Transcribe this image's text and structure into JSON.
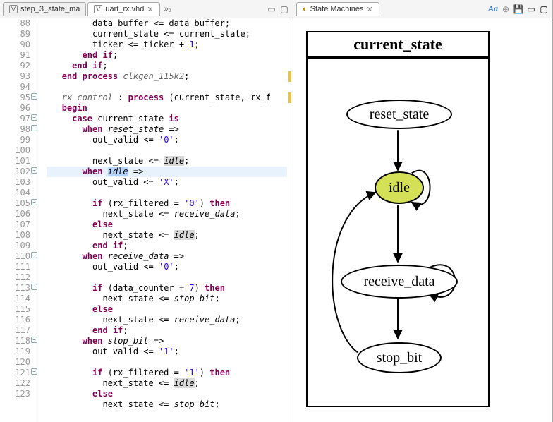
{
  "left": {
    "tabs": [
      {
        "icon": "V",
        "label": "step_3_state_ma",
        "active": false
      },
      {
        "icon": "V",
        "label": "uart_rx.vhd",
        "active": true
      }
    ],
    "overflow": "»₂",
    "lines": [
      {
        "n": 88,
        "fold": "",
        "chg": false,
        "cur": false,
        "html": "         data_buffer <span class='op'>&lt;=</span> data_buffer;"
      },
      {
        "n": 89,
        "fold": "",
        "chg": false,
        "cur": false,
        "html": "         current_state <span class='op'>&lt;=</span> current_state;"
      },
      {
        "n": 90,
        "fold": "",
        "chg": false,
        "cur": false,
        "html": "         ticker <span class='op'>&lt;=</span> ticker <span class='op'>+</span> <span class='num'>1</span>;"
      },
      {
        "n": 91,
        "fold": "",
        "chg": false,
        "cur": false,
        "html": "       <span class='kw'>end</span> <span class='kw'>if</span>;"
      },
      {
        "n": 92,
        "fold": "",
        "chg": false,
        "cur": false,
        "html": "     <span class='kw'>end</span> <span class='kw'>if</span>;"
      },
      {
        "n": 93,
        "fold": "",
        "chg": true,
        "cur": false,
        "html": "   <span class='kw'>end</span> <span class='kw'>process</span> <span class='lbl'>clkgen_115k2</span>;"
      },
      {
        "n": 94,
        "fold": "",
        "chg": false,
        "cur": false,
        "html": ""
      },
      {
        "n": 95,
        "fold": "-",
        "chg": true,
        "cur": false,
        "html": "   <span class='lbl'>rx_control</span> : <span class='kw'>process</span> (current_state, rx_f"
      },
      {
        "n": 96,
        "fold": "",
        "chg": false,
        "cur": false,
        "html": "   <span class='kw'>begin</span>"
      },
      {
        "n": 97,
        "fold": "-",
        "chg": false,
        "cur": false,
        "html": "     <span class='kw'>case</span> current_state <span class='kw'>is</span>"
      },
      {
        "n": 98,
        "fold": "-",
        "chg": false,
        "cur": false,
        "html": "       <span class='kw'>when</span> <span class='ital'>reset_state</span> <span class='op'>=&gt;</span>"
      },
      {
        "n": 99,
        "fold": "",
        "chg": false,
        "cur": false,
        "html": "         out_valid <span class='op'>&lt;=</span> <span class='str'>'0'</span>;"
      },
      {
        "n": 100,
        "fold": "",
        "chg": false,
        "cur": false,
        "html": ""
      },
      {
        "n": 101,
        "fold": "",
        "chg": false,
        "cur": false,
        "html": "         next_state <span class='op'>&lt;=</span> <span class='hl'>idle</span>;"
      },
      {
        "n": 102,
        "fold": "-",
        "chg": false,
        "cur": true,
        "html": "       <span class='kw'>when</span> <span class='sel'>idle</span> <span class='op'>=&gt;</span>"
      },
      {
        "n": 103,
        "fold": "",
        "chg": false,
        "cur": false,
        "html": "         out_valid <span class='op'>&lt;=</span> <span class='str'>'X'</span>;"
      },
      {
        "n": 104,
        "fold": "",
        "chg": false,
        "cur": false,
        "html": ""
      },
      {
        "n": 105,
        "fold": "-",
        "chg": false,
        "cur": false,
        "html": "         <span class='kw'>if</span> (rx_filtered <span class='op'>=</span> <span class='str'>'0'</span>) <span class='kw'>then</span>"
      },
      {
        "n": 106,
        "fold": "",
        "chg": false,
        "cur": false,
        "html": "           next_state <span class='op'>&lt;=</span> <span class='ital'>receive_data</span>;"
      },
      {
        "n": 107,
        "fold": "",
        "chg": false,
        "cur": false,
        "html": "         <span class='kw'>else</span>"
      },
      {
        "n": 108,
        "fold": "",
        "chg": false,
        "cur": false,
        "html": "           next_state <span class='op'>&lt;=</span> <span class='hl'>idle</span>;"
      },
      {
        "n": 109,
        "fold": "",
        "chg": false,
        "cur": false,
        "html": "         <span class='kw'>end</span> <span class='kw'>if</span>;"
      },
      {
        "n": 110,
        "fold": "-",
        "chg": false,
        "cur": false,
        "html": "       <span class='kw'>when</span> <span class='ital'>receive_data</span> <span class='op'>=&gt;</span>"
      },
      {
        "n": 111,
        "fold": "",
        "chg": false,
        "cur": false,
        "html": "         out_valid <span class='op'>&lt;=</span> <span class='str'>'0'</span>;"
      },
      {
        "n": 112,
        "fold": "",
        "chg": false,
        "cur": false,
        "html": ""
      },
      {
        "n": 113,
        "fold": "-",
        "chg": false,
        "cur": false,
        "html": "         <span class='kw'>if</span> (data_counter <span class='op'>=</span> <span class='num'>7</span>) <span class='kw'>then</span>"
      },
      {
        "n": 114,
        "fold": "",
        "chg": false,
        "cur": false,
        "html": "           next_state <span class='op'>&lt;=</span> <span class='ital'>stop_bit</span>;"
      },
      {
        "n": 115,
        "fold": "",
        "chg": false,
        "cur": false,
        "html": "         <span class='kw'>else</span>"
      },
      {
        "n": 116,
        "fold": "",
        "chg": false,
        "cur": false,
        "html": "           next_state <span class='op'>&lt;=</span> <span class='ital'>receive_data</span>;"
      },
      {
        "n": 117,
        "fold": "",
        "chg": false,
        "cur": false,
        "html": "         <span class='kw'>end</span> <span class='kw'>if</span>;"
      },
      {
        "n": 118,
        "fold": "-",
        "chg": false,
        "cur": false,
        "html": "       <span class='kw'>when</span> <span class='ital'>stop_bit</span> <span class='op'>=&gt;</span>"
      },
      {
        "n": 119,
        "fold": "",
        "chg": false,
        "cur": false,
        "html": "         out_valid <span class='op'>&lt;=</span> <span class='str'>'1'</span>;"
      },
      {
        "n": 120,
        "fold": "",
        "chg": false,
        "cur": false,
        "html": ""
      },
      {
        "n": 121,
        "fold": "-",
        "chg": false,
        "cur": false,
        "html": "         <span class='kw'>if</span> (rx_filtered <span class='op'>=</span> <span class='str'>'1'</span>) <span class='kw'>then</span>"
      },
      {
        "n": 122,
        "fold": "",
        "chg": false,
        "cur": false,
        "html": "           next_state <span class='op'>&lt;=</span> <span class='hl'>idle</span>;"
      },
      {
        "n": 123,
        "fold": "",
        "chg": false,
        "cur": false,
        "html": "         <span class='kw'>else</span>"
      },
      {
        "n": "",
        "fold": "",
        "chg": false,
        "cur": false,
        "html": "           next_state <span class='op'>&lt;=</span> <span class='ital'>stop_bit</span>;"
      }
    ]
  },
  "right": {
    "title": "State Machines",
    "fsm_title": "current_state",
    "nodes": {
      "reset": "reset_state",
      "idle": "idle",
      "recv": "receive_data",
      "stop": "stop_bit"
    }
  }
}
